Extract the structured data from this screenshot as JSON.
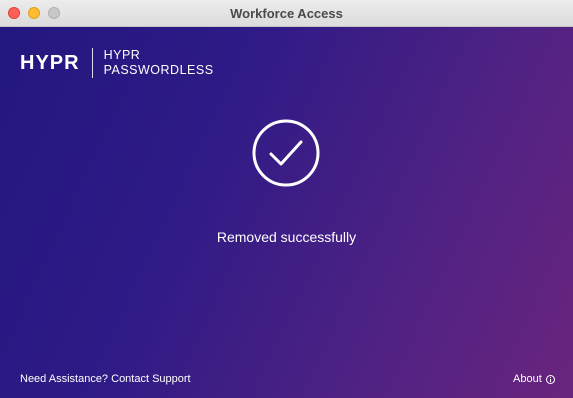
{
  "window": {
    "title": "Workforce Access"
  },
  "brand": {
    "wordmark": "HYPR",
    "sub_line1": "HYPR",
    "sub_line2": "PASSWORDLESS"
  },
  "status": {
    "icon": "checkmark-circle-icon",
    "message": "Removed successfully"
  },
  "footer": {
    "assistance_prefix": "Need Assistance?",
    "contact_link": "Contact Support",
    "about_link": "About",
    "about_icon": "info-icon"
  },
  "colors": {
    "gradient_start": "#22177f",
    "gradient_end": "#6a257e",
    "close": "#fe5f57",
    "minimize": "#febc2e",
    "zoom_inactive": "#c8c8c8",
    "text": "#ffffff"
  }
}
